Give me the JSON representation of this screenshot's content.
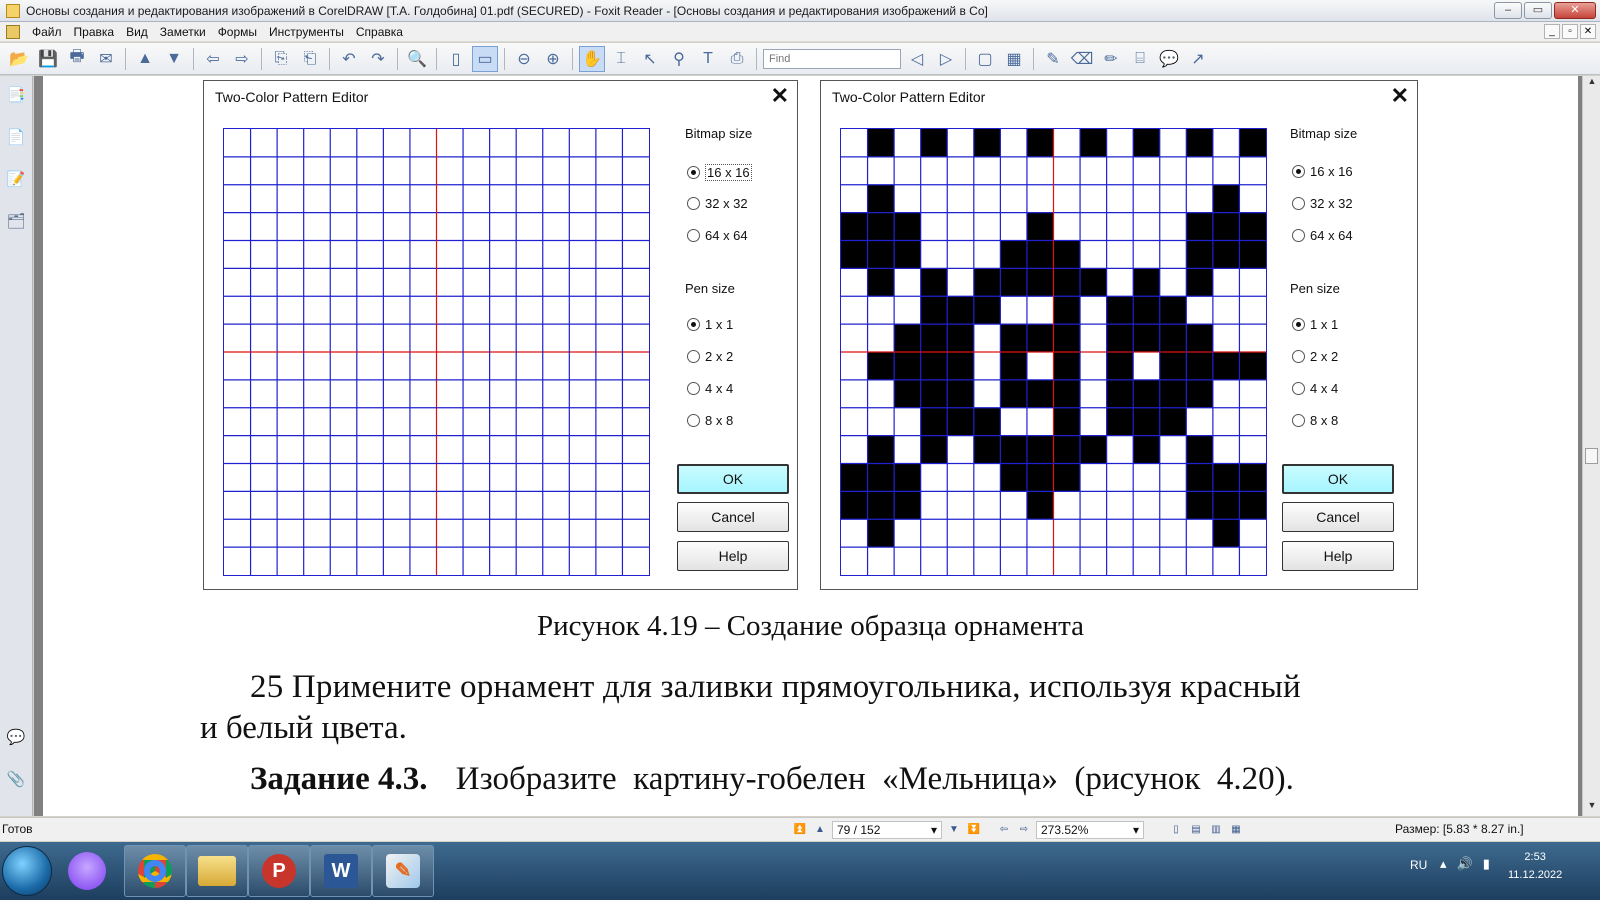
{
  "window": {
    "title": "Основы создания и редактирования изображений в CorelDRAW [Т.А. Голдобина] 01.pdf (SECURED) - Foxit Reader - [Основы создания и редактирования изображений в Co]",
    "buttons": {
      "minimize": "–",
      "maximize": "▭",
      "close": "✕"
    }
  },
  "menu": {
    "items": [
      "Файл",
      "Правка",
      "Вид",
      "Заметки",
      "Формы",
      "Инструменты",
      "Справка"
    ],
    "mdi": [
      "_",
      "▫",
      "✕"
    ]
  },
  "toolbar": {
    "find_placeholder": "Find",
    "icons": [
      "open-icon",
      "save-icon",
      "print-icon",
      "email-icon",
      "prev-page-icon",
      "next-page-icon",
      "back-icon",
      "forward-icon",
      "extract-icon",
      "insert-icon",
      "undo-icon",
      "redo-icon",
      "zoom-in-icon",
      "fit-page-icon",
      "fit-width-icon",
      "zoom-out-icon",
      "zoom-plus-icon",
      "hand-icon",
      "select-text-icon",
      "select-icon",
      "find-icon",
      "text-icon",
      "snapshot-icon"
    ]
  },
  "dialogs": [
    {
      "title": "Two-Color Pattern Editor",
      "close": "✕",
      "bitmap_label": "Bitmap size",
      "bitmap_options": [
        "16 x 16",
        "32 x 32",
        "64 x 64"
      ],
      "bitmap_selected": 0,
      "pen_label": "Pen size",
      "pen_options": [
        "1 x 1",
        "2 x 2",
        "4 x 4",
        "8 x 8"
      ],
      "pen_selected": 0,
      "ok": "OK",
      "cancel": "Cancel",
      "help": "Help",
      "pattern": [
        "................",
        "................",
        "................",
        "................",
        "................",
        "................",
        "................",
        "................",
        "................",
        "................",
        "................",
        "................",
        "................",
        "................",
        "................",
        "................"
      ]
    },
    {
      "title": "Two-Color Pattern Editor",
      "close": "✕",
      "bitmap_label": "Bitmap size",
      "bitmap_options": [
        "16 x 16",
        "32 x 32",
        "64 x 64"
      ],
      "bitmap_selected": 0,
      "pen_label": "Pen size",
      "pen_options": [
        "1 x 1",
        "2 x 2",
        "4 x 4",
        "8 x 8"
      ],
      "pen_selected": 0,
      "ok": "OK",
      "cancel": "Cancel",
      "help": "Help",
      "pattern": [
        ".#.#.#.#.#.#.#.#",
        "................",
        ".#............#.",
        "###....#.....###",
        "###...###....###",
        ".#.#.#####.#.#..",
        "...###..#.###...",
        "..###.###.####..",
        ".####.#.#.#.####",
        "..###.###.####..",
        "...###..#.###...",
        ".#.#.#####.#.#..",
        "###...###....###",
        "###....#.....###",
        ".#............#.",
        "................"
      ]
    }
  ],
  "document": {
    "caption": "Рисунок 4.19 – Создание образца орнамента",
    "para1_line1": "25 Примените орнамент для заливки прямоугольника, используя красный",
    "para1_line2": "и белый цвета.",
    "task_bold": "Задание 4.3.",
    "task_rest": "Изобразите  картину-гобелен  «Мельница»  (рисунок  4.20)."
  },
  "status": {
    "ready": "Готов",
    "page": "79 / 152",
    "zoom": "273.52%",
    "size": "Размер: [5.83 * 8.27 in.]"
  },
  "taskbar": {
    "apps": [
      "chrome-icon",
      "explorer-folder-icon",
      "foxit-reader-icon",
      "word-icon",
      "coreldraw-icon"
    ],
    "lang": "RU",
    "time": "2:53",
    "date": "11.12.2022"
  }
}
